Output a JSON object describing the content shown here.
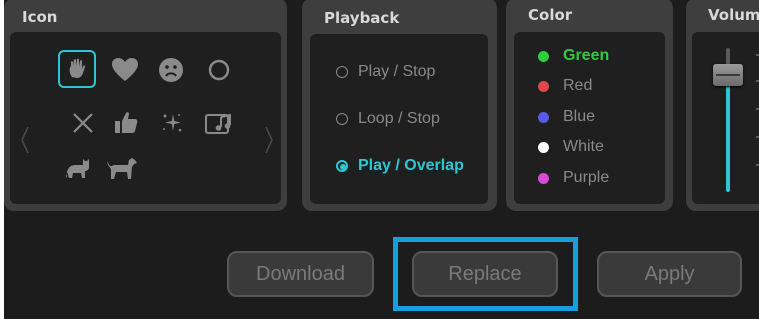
{
  "panels": {
    "icon": {
      "title": "Icon",
      "icons": [
        "hand-icon",
        "heart-icon",
        "sad-face-icon",
        "circle-icon",
        "close-icon",
        "thumbs-up-icon",
        "sparkles-icon",
        "music-icon",
        "cat-icon",
        "dog-icon"
      ],
      "selected": "hand-icon"
    },
    "playback": {
      "title": "Playback",
      "options": [
        "Play / Stop",
        "Loop / Stop",
        "Play / Overlap"
      ],
      "selected": "Play / Overlap"
    },
    "color": {
      "title": "Color",
      "options": [
        {
          "label": "Green",
          "color": "#2ecc40"
        },
        {
          "label": "Red",
          "color": "#e04848"
        },
        {
          "label": "Blue",
          "color": "#5a5ae8"
        },
        {
          "label": "White",
          "color": "#ffffff"
        },
        {
          "label": "Purple",
          "color": "#d84ad8"
        }
      ],
      "selected": "Green"
    },
    "volume": {
      "title": "Volum",
      "level": 0.8
    }
  },
  "buttons": {
    "download": "Download",
    "replace": "Replace",
    "apply": "Apply"
  },
  "accent": "#2fc6d2",
  "highlight_color": "#169fe0"
}
